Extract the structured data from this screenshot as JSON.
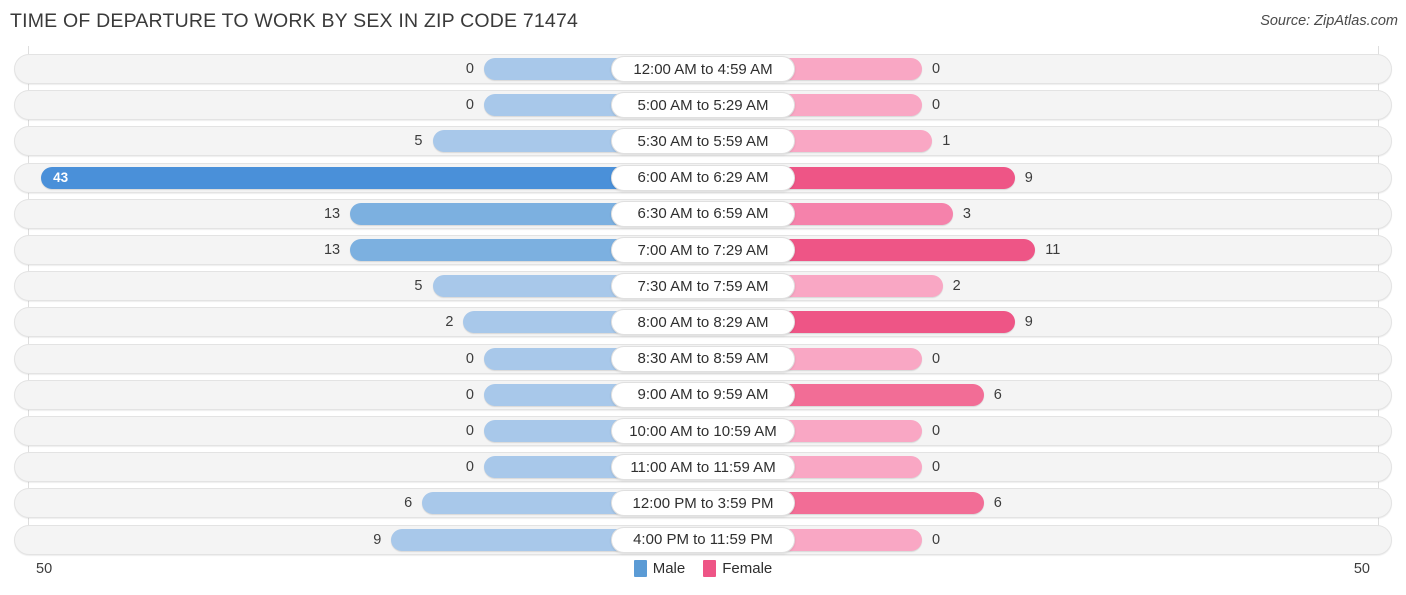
{
  "header": {
    "title": "TIME OF DEPARTURE TO WORK BY SEX IN ZIP CODE 71474",
    "source": "Source: ZipAtlas.com"
  },
  "legend": {
    "male_label": "Male",
    "female_label": "Female",
    "male_color": "#5b9bd5",
    "female_color": "#ee5586"
  },
  "axis": {
    "left_max": "50",
    "right_max": "50"
  },
  "chart_data": {
    "type": "bar",
    "subtype": "diverging-bidirectional",
    "title": "TIME OF DEPARTURE TO WORK BY SEX IN ZIP CODE 71474",
    "xlabel": "",
    "ylabel": "",
    "xlim": [
      50,
      50
    ],
    "grid": true,
    "legend_position": "bottom-center",
    "categories": [
      "12:00 AM to 4:59 AM",
      "5:00 AM to 5:29 AM",
      "5:30 AM to 5:59 AM",
      "6:00 AM to 6:29 AM",
      "6:30 AM to 6:59 AM",
      "7:00 AM to 7:29 AM",
      "7:30 AM to 7:59 AM",
      "8:00 AM to 8:29 AM",
      "8:30 AM to 8:59 AM",
      "9:00 AM to 9:59 AM",
      "10:00 AM to 10:59 AM",
      "11:00 AM to 11:59 AM",
      "12:00 PM to 3:59 PM",
      "4:00 PM to 11:59 PM"
    ],
    "series": [
      {
        "name": "Male",
        "values": [
          0,
          0,
          5,
          43,
          13,
          13,
          5,
          2,
          0,
          0,
          0,
          0,
          6,
          9
        ]
      },
      {
        "name": "Female",
        "values": [
          0,
          0,
          1,
          9,
          3,
          11,
          2,
          9,
          0,
          0,
          0,
          0,
          6,
          0
        ]
      }
    ]
  },
  "rows": [
    {
      "label": "12:00 AM to 4:59 AM",
      "male": "0",
      "female": "0",
      "male_val": 0,
      "female_val": 0
    },
    {
      "label": "5:00 AM to 5:29 AM",
      "male": "0",
      "female": "0",
      "male_val": 0,
      "female_val": 0
    },
    {
      "label": "5:30 AM to 5:59 AM",
      "male": "5",
      "female": "1",
      "male_val": 5,
      "female_val": 1
    },
    {
      "label": "6:00 AM to 6:29 AM",
      "male": "43",
      "female": "9",
      "male_val": 43,
      "female_val": 9
    },
    {
      "label": "6:30 AM to 6:59 AM",
      "male": "13",
      "female": "3",
      "male_val": 13,
      "female_val": 3
    },
    {
      "label": "7:00 AM to 7:29 AM",
      "male": "13",
      "female": "11",
      "male_val": 13,
      "female_val": 11
    },
    {
      "label": "7:30 AM to 7:59 AM",
      "male": "5",
      "female": "2",
      "male_val": 5,
      "female_val": 2
    },
    {
      "label": "8:00 AM to 8:29 AM",
      "male": "2",
      "female": "9",
      "male_val": 2,
      "female_val": 9
    },
    {
      "label": "8:30 AM to 8:59 AM",
      "male": "0",
      "female": "0",
      "male_val": 0,
      "female_val": 0
    },
    {
      "label": "9:00 AM to 9:59 AM",
      "male": "0",
      "female": "6",
      "male_val": 0,
      "female_val": 6
    },
    {
      "label": "10:00 AM to 10:59 AM",
      "male": "0",
      "female": "0",
      "male_val": 0,
      "female_val": 0
    },
    {
      "label": "11:00 AM to 11:59 AM",
      "male": "0",
      "female": "0",
      "male_val": 0,
      "female_val": 0
    },
    {
      "label": "12:00 PM to 3:59 PM",
      "male": "6",
      "female": "6",
      "male_val": 6,
      "female_val": 6
    },
    {
      "label": "4:00 PM to 11:59 PM",
      "male": "9",
      "female": "0",
      "male_val": 9,
      "female_val": 0
    }
  ]
}
